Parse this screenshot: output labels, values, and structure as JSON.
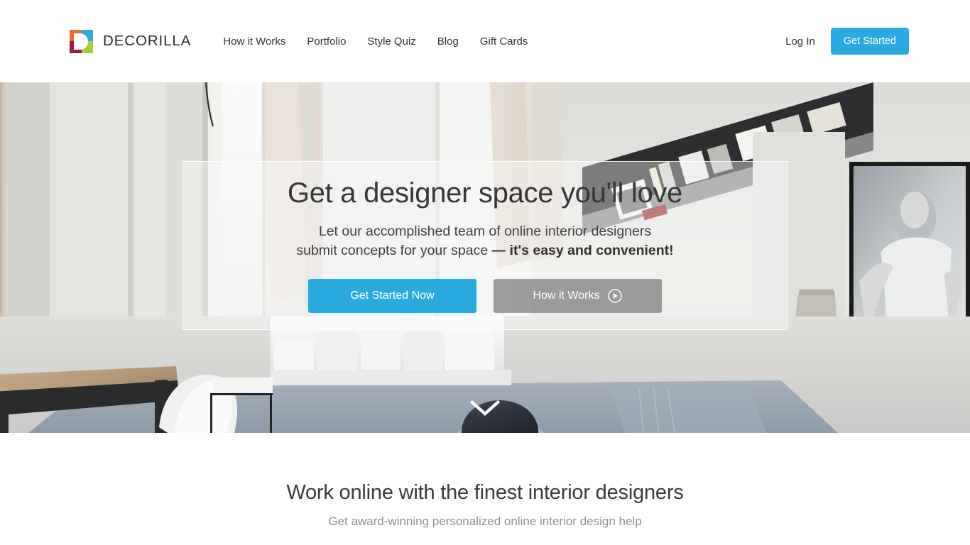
{
  "brand": {
    "name": "DECORILLA",
    "logo_colors": {
      "top_left": "#e8702a",
      "top_right": "#29abe2",
      "bottom_left": "#9b1b45",
      "bottom_right": "#a6ce39"
    }
  },
  "nav": {
    "items": [
      {
        "label": "How it Works"
      },
      {
        "label": "Portfolio"
      },
      {
        "label": "Style Quiz"
      },
      {
        "label": "Blog"
      },
      {
        "label": "Gift Cards"
      }
    ],
    "login_label": "Log In",
    "get_started_label": "Get Started",
    "accent_color": "#29abe2"
  },
  "hero": {
    "title": "Get a designer space you'll love",
    "subtitle_line1": "Let our accomplished team of online interior designers",
    "subtitle_line2_normal": "submit concepts for your space ",
    "subtitle_line2_bold": "— it's easy and convenient!",
    "primary_cta": "Get Started Now",
    "secondary_cta": "How it Works",
    "scroll_hint": "scroll-down"
  },
  "section": {
    "title": "Work online with the finest interior designers",
    "subtitle": "Get award-winning personalized online interior design help"
  }
}
